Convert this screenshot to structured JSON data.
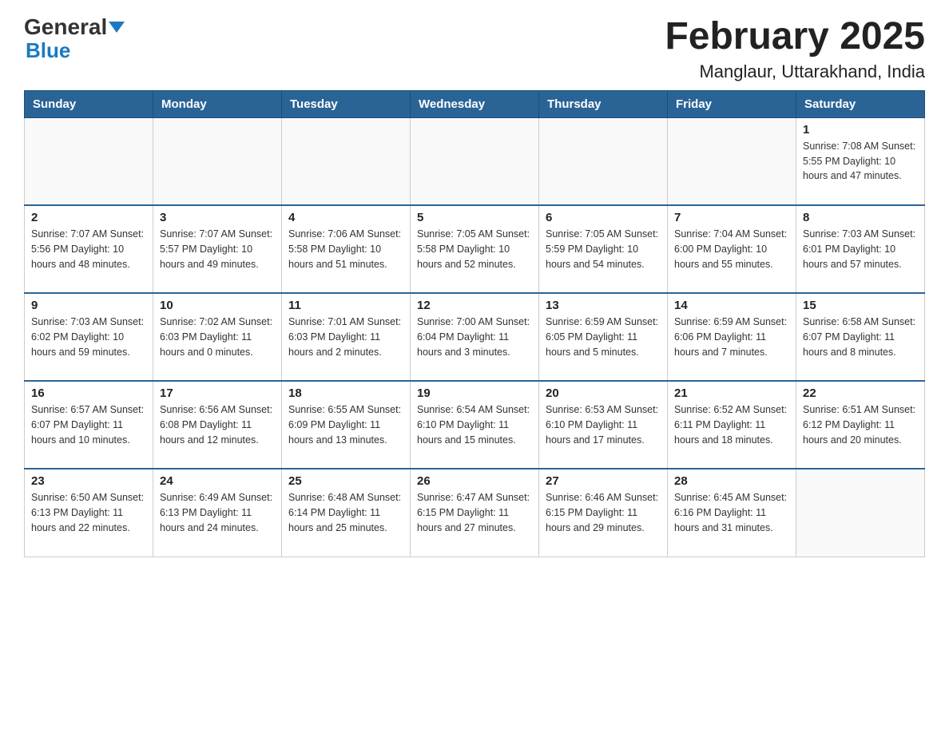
{
  "logo": {
    "text1": "General",
    "text2": "Blue"
  },
  "title": "February 2025",
  "subtitle": "Manglaur, Uttarakhand, India",
  "weekdays": [
    "Sunday",
    "Monday",
    "Tuesday",
    "Wednesday",
    "Thursday",
    "Friday",
    "Saturday"
  ],
  "weeks": [
    [
      {
        "day": "",
        "info": ""
      },
      {
        "day": "",
        "info": ""
      },
      {
        "day": "",
        "info": ""
      },
      {
        "day": "",
        "info": ""
      },
      {
        "day": "",
        "info": ""
      },
      {
        "day": "",
        "info": ""
      },
      {
        "day": "1",
        "info": "Sunrise: 7:08 AM\nSunset: 5:55 PM\nDaylight: 10 hours and 47 minutes."
      }
    ],
    [
      {
        "day": "2",
        "info": "Sunrise: 7:07 AM\nSunset: 5:56 PM\nDaylight: 10 hours and 48 minutes."
      },
      {
        "day": "3",
        "info": "Sunrise: 7:07 AM\nSunset: 5:57 PM\nDaylight: 10 hours and 49 minutes."
      },
      {
        "day": "4",
        "info": "Sunrise: 7:06 AM\nSunset: 5:58 PM\nDaylight: 10 hours and 51 minutes."
      },
      {
        "day": "5",
        "info": "Sunrise: 7:05 AM\nSunset: 5:58 PM\nDaylight: 10 hours and 52 minutes."
      },
      {
        "day": "6",
        "info": "Sunrise: 7:05 AM\nSunset: 5:59 PM\nDaylight: 10 hours and 54 minutes."
      },
      {
        "day": "7",
        "info": "Sunrise: 7:04 AM\nSunset: 6:00 PM\nDaylight: 10 hours and 55 minutes."
      },
      {
        "day": "8",
        "info": "Sunrise: 7:03 AM\nSunset: 6:01 PM\nDaylight: 10 hours and 57 minutes."
      }
    ],
    [
      {
        "day": "9",
        "info": "Sunrise: 7:03 AM\nSunset: 6:02 PM\nDaylight: 10 hours and 59 minutes."
      },
      {
        "day": "10",
        "info": "Sunrise: 7:02 AM\nSunset: 6:03 PM\nDaylight: 11 hours and 0 minutes."
      },
      {
        "day": "11",
        "info": "Sunrise: 7:01 AM\nSunset: 6:03 PM\nDaylight: 11 hours and 2 minutes."
      },
      {
        "day": "12",
        "info": "Sunrise: 7:00 AM\nSunset: 6:04 PM\nDaylight: 11 hours and 3 minutes."
      },
      {
        "day": "13",
        "info": "Sunrise: 6:59 AM\nSunset: 6:05 PM\nDaylight: 11 hours and 5 minutes."
      },
      {
        "day": "14",
        "info": "Sunrise: 6:59 AM\nSunset: 6:06 PM\nDaylight: 11 hours and 7 minutes."
      },
      {
        "day": "15",
        "info": "Sunrise: 6:58 AM\nSunset: 6:07 PM\nDaylight: 11 hours and 8 minutes."
      }
    ],
    [
      {
        "day": "16",
        "info": "Sunrise: 6:57 AM\nSunset: 6:07 PM\nDaylight: 11 hours and 10 minutes."
      },
      {
        "day": "17",
        "info": "Sunrise: 6:56 AM\nSunset: 6:08 PM\nDaylight: 11 hours and 12 minutes."
      },
      {
        "day": "18",
        "info": "Sunrise: 6:55 AM\nSunset: 6:09 PM\nDaylight: 11 hours and 13 minutes."
      },
      {
        "day": "19",
        "info": "Sunrise: 6:54 AM\nSunset: 6:10 PM\nDaylight: 11 hours and 15 minutes."
      },
      {
        "day": "20",
        "info": "Sunrise: 6:53 AM\nSunset: 6:10 PM\nDaylight: 11 hours and 17 minutes."
      },
      {
        "day": "21",
        "info": "Sunrise: 6:52 AM\nSunset: 6:11 PM\nDaylight: 11 hours and 18 minutes."
      },
      {
        "day": "22",
        "info": "Sunrise: 6:51 AM\nSunset: 6:12 PM\nDaylight: 11 hours and 20 minutes."
      }
    ],
    [
      {
        "day": "23",
        "info": "Sunrise: 6:50 AM\nSunset: 6:13 PM\nDaylight: 11 hours and 22 minutes."
      },
      {
        "day": "24",
        "info": "Sunrise: 6:49 AM\nSunset: 6:13 PM\nDaylight: 11 hours and 24 minutes."
      },
      {
        "day": "25",
        "info": "Sunrise: 6:48 AM\nSunset: 6:14 PM\nDaylight: 11 hours and 25 minutes."
      },
      {
        "day": "26",
        "info": "Sunrise: 6:47 AM\nSunset: 6:15 PM\nDaylight: 11 hours and 27 minutes."
      },
      {
        "day": "27",
        "info": "Sunrise: 6:46 AM\nSunset: 6:15 PM\nDaylight: 11 hours and 29 minutes."
      },
      {
        "day": "28",
        "info": "Sunrise: 6:45 AM\nSunset: 6:16 PM\nDaylight: 11 hours and 31 minutes."
      },
      {
        "day": "",
        "info": ""
      }
    ]
  ]
}
